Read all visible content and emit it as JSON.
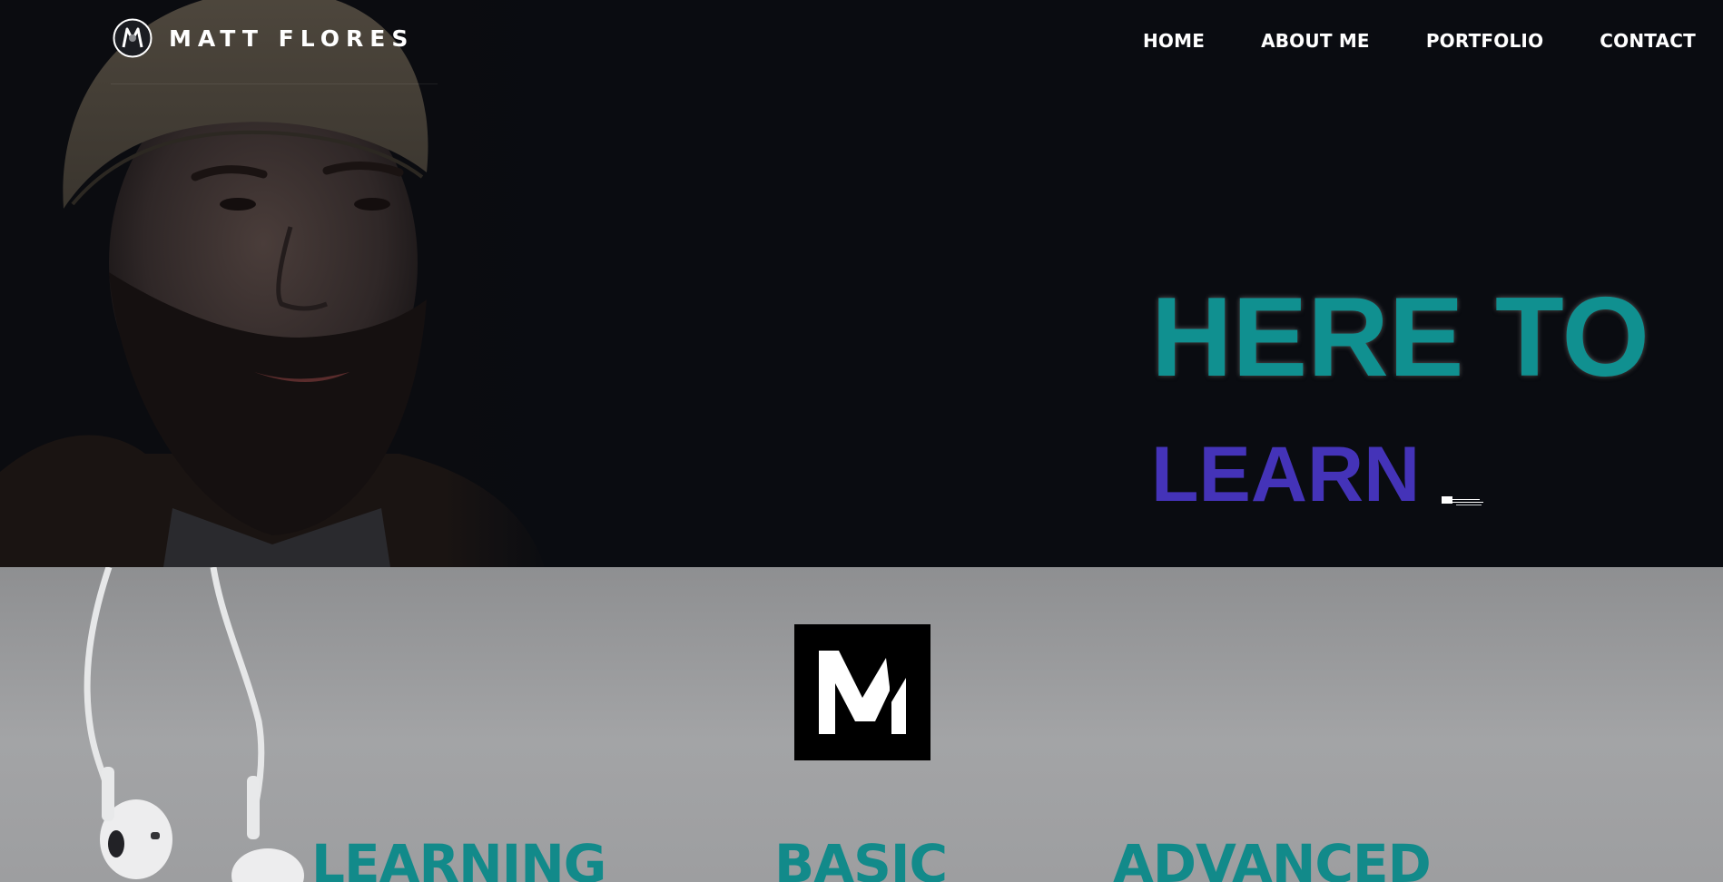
{
  "brand": {
    "name": "MATT FLORES",
    "logo_icon": "circle-monogram-icon",
    "mark_icon": "m-monogram-icon"
  },
  "nav": {
    "items": [
      {
        "label": "HOME"
      },
      {
        "label": "ABOUT ME"
      },
      {
        "label": "PORTFOLIO"
      },
      {
        "label": "CONTACT"
      }
    ]
  },
  "hero": {
    "line1": "HERE TO",
    "line2": "LEARN",
    "photo": "portrait-photo"
  },
  "levels": {
    "items": [
      {
        "label": "LEARNING"
      },
      {
        "label": "BASIC"
      },
      {
        "label": "ADVANCED"
      }
    ]
  },
  "colors": {
    "hero_background": "#0a0c11",
    "accent_teal": "#109090",
    "accent_purple": "#4433b8",
    "nav_text": "#ffffff",
    "lower_background": "#9d9ea0"
  }
}
